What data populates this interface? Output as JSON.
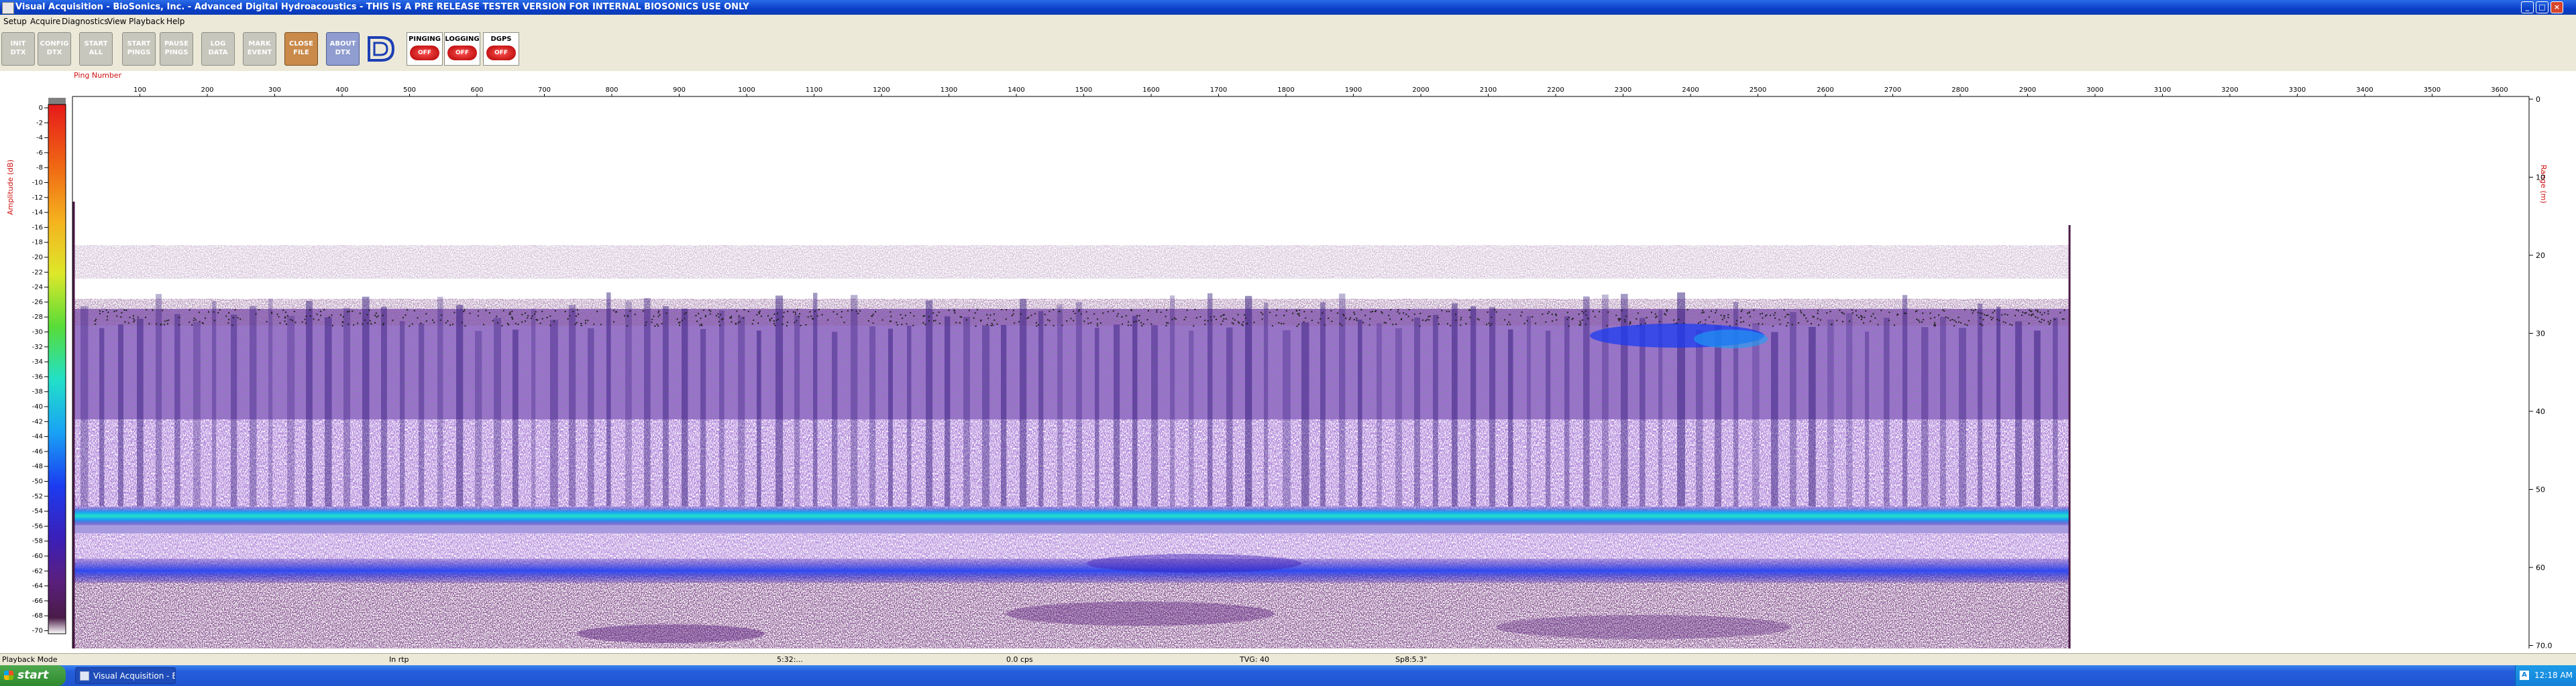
{
  "window": {
    "title": "Visual Acquisition  -  BioSonics, Inc.  -  Advanced Digital Hydroacoustics  -  THIS IS A PRE RELEASE TESTER VERSION FOR INTERNAL BIOSONICS USE ONLY",
    "minimize": "_",
    "maximize": "□",
    "close": "×"
  },
  "menu": [
    "Setup",
    "Acquire",
    "Diagnostics",
    "View",
    "Playback",
    "Help"
  ],
  "toolbar": {
    "buttons": [
      {
        "name": "init-dtx-button",
        "l1": "INIT",
        "l2": "DTX"
      },
      {
        "name": "config-dtx-button",
        "l1": "CONFIG",
        "l2": "DTX"
      },
      {
        "name": "start-all-button",
        "l1": "START",
        "l2": "ALL"
      },
      {
        "name": "start-pings-button",
        "l1": "START",
        "l2": "PINGS"
      },
      {
        "name": "pause-pings-button",
        "l1": "PAUSE",
        "l2": "PINGS"
      },
      {
        "name": "log-data-button",
        "l1": "LOG",
        "l2": "DATA"
      },
      {
        "name": "mark-event-button",
        "l1": "MARK",
        "l2": "EVENT"
      },
      {
        "name": "close-file-button",
        "l1": "CLOSE",
        "l2": "FILE"
      },
      {
        "name": "about-dtx-button",
        "l1": "ABOUT",
        "l2": "DTX"
      }
    ],
    "indicators": [
      {
        "name": "pinging-indicator",
        "label": "PINGING",
        "state": "OFF"
      },
      {
        "name": "logging-indicator",
        "label": "LOGGING",
        "state": "OFF"
      },
      {
        "name": "dgps-indicator",
        "label": "DGPS",
        "state": "OFF"
      }
    ]
  },
  "echogram": {
    "top_axis_label": "Ping Number",
    "ping_ticks": [
      100,
      200,
      300,
      400,
      500,
      600,
      700,
      800,
      900,
      1000,
      1100,
      1200,
      1300,
      1400,
      1500,
      1600,
      1700,
      1800,
      1900,
      2000,
      2100,
      2200,
      2300,
      2400,
      2500,
      2600,
      2700,
      2800,
      2900,
      3000,
      3100,
      3200,
      3300,
      3400,
      3500,
      3600
    ],
    "left_axis_label": "Amplitude (dB)",
    "amp_ticks": [
      0,
      -2,
      -4,
      -6,
      -8,
      -10,
      -12,
      -14,
      -16,
      -18,
      -20,
      -22,
      -24,
      -26,
      -28,
      -30,
      -32,
      -34,
      -36,
      -38,
      -40,
      -42,
      -44,
      -46,
      -48,
      -50,
      -52,
      -54,
      -56,
      -58,
      -60,
      -62,
      -64,
      -66,
      -68,
      -70
    ],
    "right_axis_label": "Range (m)",
    "range_ticks": [
      "0",
      "10",
      "20",
      "30",
      "40",
      "50",
      "60",
      "70.0"
    ],
    "colors": {
      "palette": [
        "#ffffff",
        "#4a1b48",
        "#5a1f7e",
        "#3b1fb8",
        "#1b3cf0",
        "#19a2f5",
        "#22e0c8",
        "#58dc38",
        "#dde82a",
        "#f5b21e",
        "#f06a14",
        "#e61a1a"
      ]
    }
  },
  "status": {
    "mode": "Playback Mode",
    "s2": "In rtp",
    "s3": "5:32:...",
    "s4": "0.0 cps",
    "s5": "TVG: 40",
    "s6": "Sp8:5.3\""
  },
  "taskbar": {
    "start": "start",
    "task_label": "Visual Acquisition  -  B...",
    "clock": "12:18 AM"
  }
}
